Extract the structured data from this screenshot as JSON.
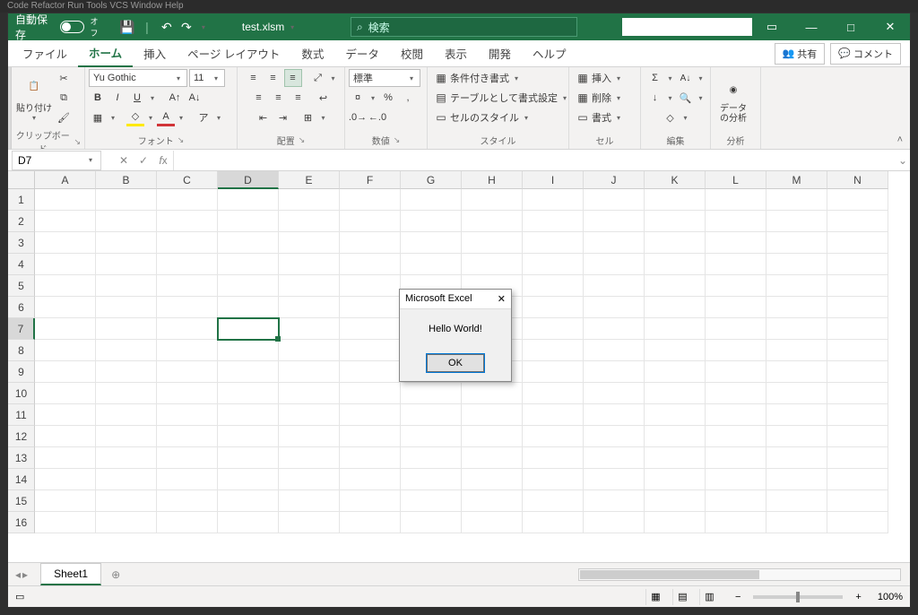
{
  "outer_chrome": "Code   Refactor   Run   Tools   VCS   Window   Help",
  "titlebar": {
    "autosave_label": "自動保存",
    "autosave_state": "オフ",
    "filename": "test.xlsm",
    "search_placeholder": "検索"
  },
  "tabs": {
    "file": "ファイル",
    "home": "ホーム",
    "insert": "挿入",
    "pagelayout": "ページ レイアウト",
    "formulas": "数式",
    "data": "データ",
    "review": "校閲",
    "view": "表示",
    "developer": "開発",
    "help": "ヘルプ",
    "share": "共有",
    "comments": "コメント"
  },
  "ribbon": {
    "clipboard": {
      "paste": "貼り付け",
      "label": "クリップボード"
    },
    "font": {
      "name": "Yu Gothic",
      "size": "11",
      "label": "フォント"
    },
    "alignment": {
      "label": "配置"
    },
    "number": {
      "format": "標準",
      "label": "数値"
    },
    "styles": {
      "cond": "条件付き書式",
      "table": "テーブルとして書式設定",
      "cell": "セルのスタイル",
      "label": "スタイル"
    },
    "cells": {
      "insert": "挿入",
      "delete": "削除",
      "format": "書式",
      "label": "セル"
    },
    "editing": {
      "label": "編集"
    },
    "analysis": {
      "btn": "データ\nの分析",
      "label": "分析"
    }
  },
  "namebox": "D7",
  "columns": [
    "A",
    "B",
    "C",
    "D",
    "E",
    "F",
    "G",
    "H",
    "I",
    "J",
    "K",
    "L",
    "M",
    "N"
  ],
  "rows": [
    "1",
    "2",
    "3",
    "4",
    "5",
    "6",
    "7",
    "8",
    "9",
    "10",
    "11",
    "12",
    "13",
    "14",
    "15",
    "16"
  ],
  "selected": {
    "col": "D",
    "row": "7"
  },
  "dialog": {
    "title": "Microsoft Excel",
    "message": "Hello World!",
    "ok": "OK"
  },
  "sheet": {
    "name": "Sheet1"
  },
  "status": {
    "zoom": "100%"
  }
}
